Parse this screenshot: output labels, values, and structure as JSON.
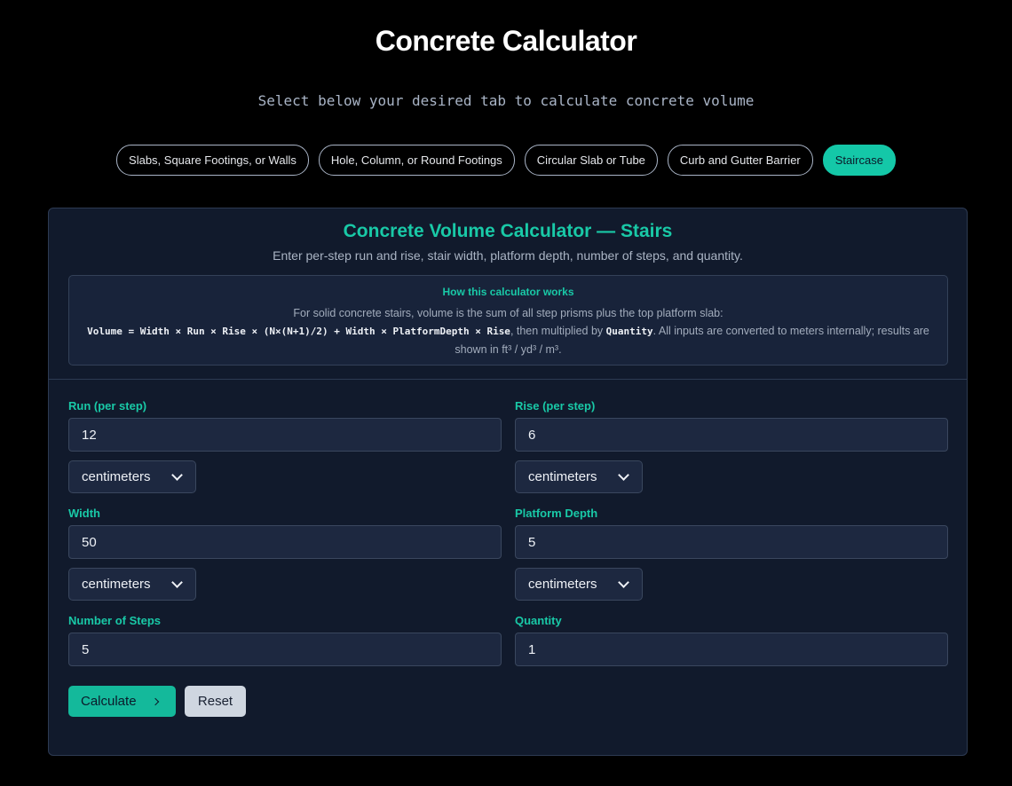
{
  "header": {
    "title": "Concrete Calculator",
    "subtitle": "Select below your desired tab to calculate concrete volume"
  },
  "tabs": [
    {
      "label": "Slabs, Square Footings, or Walls",
      "active": false
    },
    {
      "label": "Hole, Column, or Round Footings",
      "active": false
    },
    {
      "label": "Circular Slab or Tube",
      "active": false
    },
    {
      "label": "Curb and Gutter Barrier",
      "active": false
    },
    {
      "label": "Staircase",
      "active": true
    }
  ],
  "calculator": {
    "title": "Concrete Volume Calculator — Stairs",
    "description": "Enter per-step run and rise, stair width, platform depth, number of steps, and quantity.",
    "info": {
      "title": "How this calculator works",
      "line1": "For solid concrete stairs, volume is the sum of all step prisms plus the top platform slab:",
      "formula": "Volume = Width × Run × Rise × (N×(N+1)/2) + Width × PlatformDepth × Rise",
      "mid": ", then multiplied by ",
      "quantity_word": "Quantity",
      "tail": ". All inputs are converted to meters internally; results are shown in ft³ / yd³ / m³."
    },
    "fields": {
      "run": {
        "label": "Run (per step)",
        "value": "12",
        "unit": "centimeters"
      },
      "rise": {
        "label": "Rise (per step)",
        "value": "6",
        "unit": "centimeters"
      },
      "width": {
        "label": "Width",
        "value": "50",
        "unit": "centimeters"
      },
      "platform_depth": {
        "label": "Platform Depth",
        "value": "5",
        "unit": "centimeters"
      },
      "steps": {
        "label": "Number of Steps",
        "value": "5"
      },
      "quantity": {
        "label": "Quantity",
        "value": "1"
      }
    },
    "buttons": {
      "calculate": "Calculate",
      "reset": "Reset"
    }
  },
  "colors": {
    "accent": "#19c9a7",
    "background": "#000000",
    "card": "#111a2c",
    "input": "#1d2840"
  }
}
